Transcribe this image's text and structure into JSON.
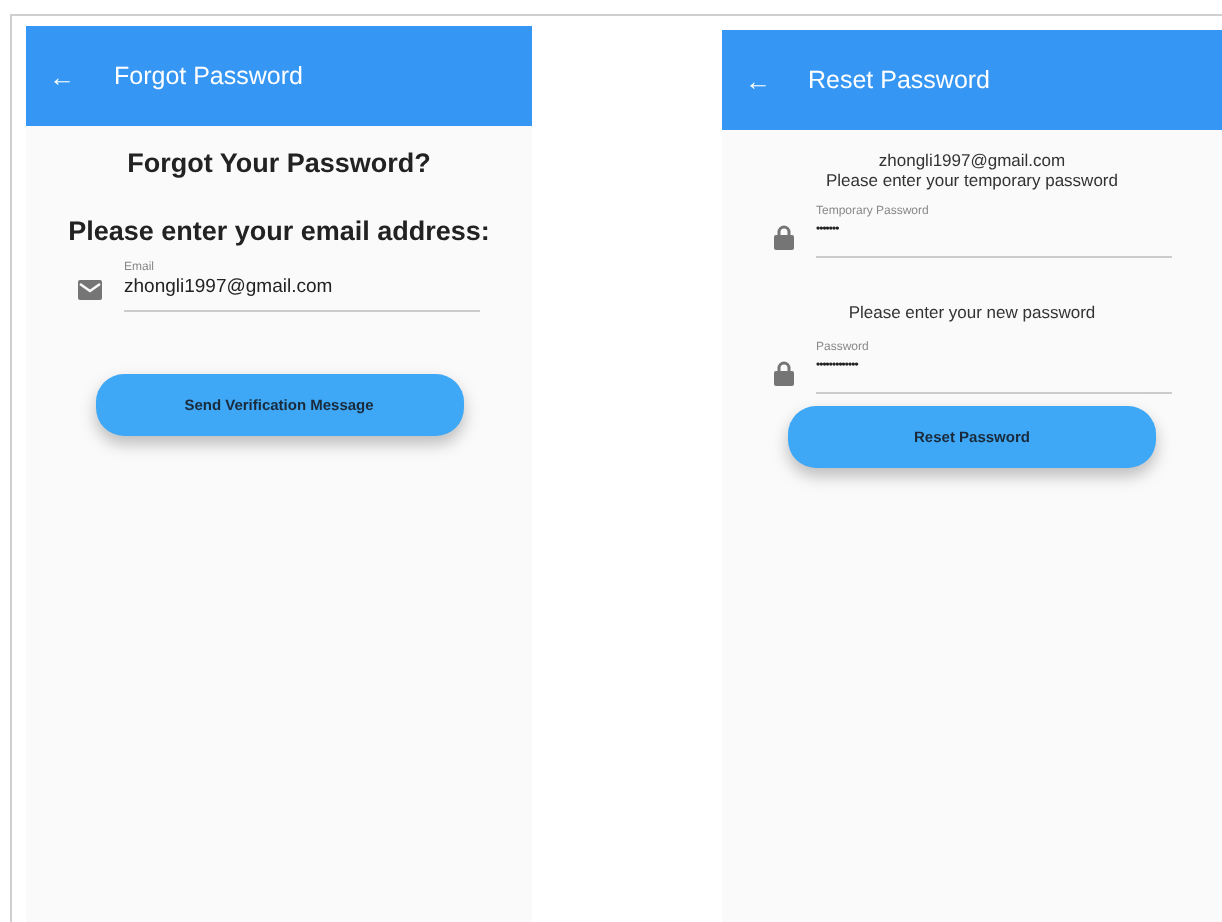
{
  "screens": [
    {
      "app_bar": {
        "back": "←",
        "title": "Forgot Password"
      },
      "heading": "Forgot Your Password?",
      "prompt": "Please enter your email address:",
      "fields": [
        {
          "kind": "email",
          "label": "Email",
          "value": "zhongli1997@gmail.com"
        }
      ],
      "button": "Send Verification Message"
    },
    {
      "app_bar": {
        "back": "←",
        "title": "Reset Password"
      },
      "email": "zhongli1997@gmail.com",
      "prompt": "Please enter your temporary password",
      "fields": [
        {
          "kind": "password",
          "label": "Temporary Password",
          "value": "•••••••"
        },
        {
          "kind": "password",
          "label": "Password",
          "value": "•••••••••••••",
          "note": "Please enter your new password"
        }
      ],
      "button": "Reset Password"
    }
  ]
}
